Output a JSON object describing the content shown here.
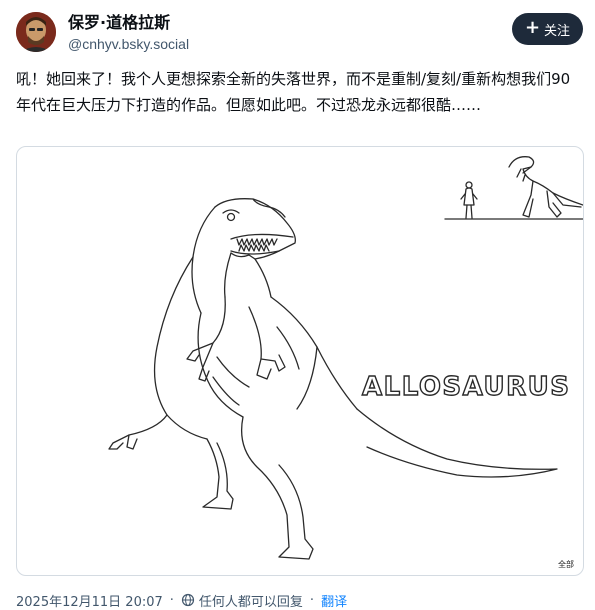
{
  "post": {
    "author": {
      "display_name": "保罗·道格拉斯",
      "handle": "@cnhyv.bsky.social"
    },
    "follow_label": "关注",
    "text": "吼！她回来了！我个人更想探索全新的失落世界，而不是重制/复刻/重新构想我们90年代在巨大压力下打造的作品。但愿如此吧。不过恐龙永远都很酷……",
    "image": {
      "sign_text": "ALLOSAURUS",
      "alt_badge": "全部"
    },
    "footer": {
      "timestamp": "2025年12月11日 20:07",
      "reply_setting": "任何人都可以回复",
      "translate_label": "翻译"
    }
  },
  "colors": {
    "follow_button_bg": "#1e2a3a",
    "handle_gray": "#42576c",
    "link_blue": "#1083fe",
    "card_border": "#d4dbe2"
  },
  "icons": [
    "avatar-portrait",
    "plus-icon",
    "globe-icon"
  ]
}
